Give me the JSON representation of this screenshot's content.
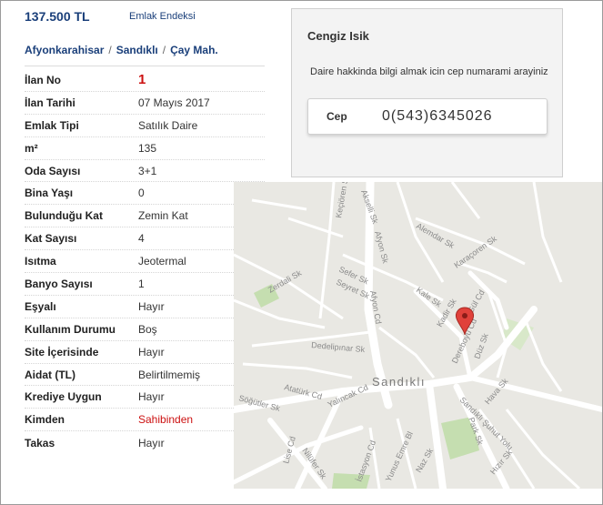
{
  "price": "137.500 TL",
  "endeks_link": "Emlak Endeksi",
  "breadcrumb": [
    "Afyonkarahisar",
    "Sandıklı",
    "Çay Mah."
  ],
  "breadcrumb_sep": "/",
  "details": [
    {
      "key": "İlan No",
      "value": "1"
    },
    {
      "key": "İlan Tarihi",
      "value": "07 Mayıs 2017"
    },
    {
      "key": "Emlak Tipi",
      "value": "Satılık Daire"
    },
    {
      "key": "m²",
      "value": "135"
    },
    {
      "key": "Oda Sayısı",
      "value": "3+1"
    },
    {
      "key": "Bina Yaşı",
      "value": "0"
    },
    {
      "key": "Bulunduğu Kat",
      "value": "Zemin Kat"
    },
    {
      "key": "Kat Sayısı",
      "value": "4"
    },
    {
      "key": "Isıtma",
      "value": "Jeotermal"
    },
    {
      "key": "Banyo Sayısı",
      "value": "1"
    },
    {
      "key": "Eşyalı",
      "value": "Hayır"
    },
    {
      "key": "Kullanım Durumu",
      "value": "Boş"
    },
    {
      "key": "Site İçerisinde",
      "value": "Hayır"
    },
    {
      "key": "Aidat (TL)",
      "value": "Belirtilmemiş"
    },
    {
      "key": "Krediye Uygun",
      "value": "Hayır"
    },
    {
      "key": "Kimden",
      "value": "Sahibinden"
    },
    {
      "key": "Takas",
      "value": "Hayır"
    }
  ],
  "contact": {
    "name": "Cengiz Isik",
    "message": "Daire hakkinda bilgi almak icin cep numarami arayiniz",
    "phone_label": "Cep",
    "phone_number": "0(543)6345026"
  },
  "map": {
    "city": "Sandıklı",
    "streets": [
      "Keçiören Sk",
      "Akselli Sk",
      "Afyon Sk",
      "Alemdar Sk",
      "Karaçoren Sk",
      "Sefer Sk",
      "Seyret Sk",
      "Kale Sk",
      "Kadir Sk",
      "Gül Cd",
      "Zerdali Sk",
      "Dedelipınar Sk",
      "Afyon Cd",
      "Dereboyu Cd",
      "Düz Sk",
      "Atatürk Cd",
      "Yalıncak Cd",
      "Nilüfer Sk",
      "Söğütler Sk",
      "Lise Cd",
      "İstasyon Cd",
      "Yunus Emre Bl",
      "Naz Sk",
      "Sandıklı Şuhut Yolu",
      "Park Sk",
      "Hızır Sk",
      "Hava Sk"
    ],
    "pin_icon": "map-pin-icon",
    "pin_color": "#e0413a"
  },
  "colors": {
    "link": "#1a3f7a",
    "highlight": "#cc1111"
  }
}
